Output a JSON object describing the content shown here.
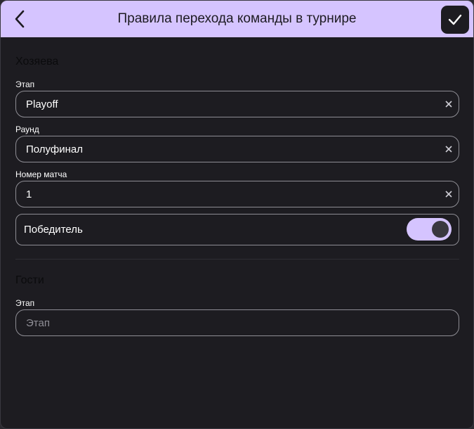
{
  "header": {
    "title": "Правила перехода команды в турнире",
    "back_icon": "chevron-left-icon",
    "confirm_icon": "check-icon"
  },
  "home": {
    "section_title": "Хозяева",
    "stage": {
      "label": "Этап",
      "value": "Playoff"
    },
    "round": {
      "label": "Раунд",
      "value": "Полуфинал"
    },
    "match_number": {
      "label": "Номер матча",
      "value": "1"
    },
    "winner": {
      "label": "Победитель",
      "enabled": true
    }
  },
  "guests": {
    "section_title": "Гости",
    "stage": {
      "label": "Этап",
      "placeholder": "Этап"
    }
  },
  "colors": {
    "accent": "#d5c4ff",
    "background": "#1d1c21",
    "field_border": "#8e8d94"
  }
}
